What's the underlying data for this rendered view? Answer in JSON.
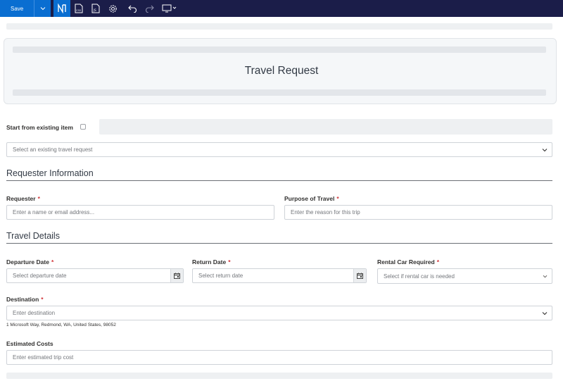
{
  "toolbar": {
    "save_label": "Save",
    "icons": [
      "chevron-down-icon",
      "form-logo-icon",
      "css-file-icon",
      "js-file-icon",
      "settings-gear-icon",
      "undo-icon",
      "redo-icon",
      "preview-monitor-icon"
    ]
  },
  "header": {
    "title": "Travel Request"
  },
  "existing": {
    "label": "Start from existing item",
    "dropdown_placeholder": "Select an existing travel request"
  },
  "requester_section": {
    "title": "Requester Information",
    "requester": {
      "label": "Requester",
      "required_mark": "*",
      "placeholder": "Enter a name or email address..."
    },
    "purpose": {
      "label": "Purpose of Travel",
      "required_mark": "*",
      "placeholder": "Enter the reason for this trip"
    }
  },
  "travel_section": {
    "title": "Travel Details",
    "departure": {
      "label": "Departure Date",
      "required_mark": "*",
      "placeholder": "Select departure date"
    },
    "return": {
      "label": "Return Date",
      "required_mark": "*",
      "placeholder": "Select return date"
    },
    "rental": {
      "label": "Rental Car Required",
      "required_mark": "*",
      "placeholder": "Select if rental car is needed"
    },
    "destination": {
      "label": "Destination",
      "required_mark": "*",
      "placeholder": "Enter destination",
      "helper": "1 Microsoft Way, Redmond, WA, United States, 98052"
    },
    "costs": {
      "label": "Estimated Costs",
      "placeholder": "Enter estimated trip cost"
    }
  },
  "colors": {
    "toolbar_bg": "#1b1d49",
    "accent": "#0a6ed1",
    "required": "#d13438"
  }
}
